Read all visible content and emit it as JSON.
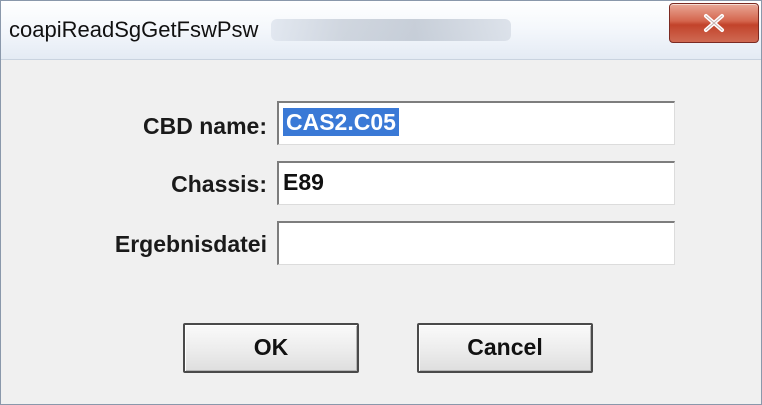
{
  "window": {
    "title": "coapiReadSgGetFswPsw",
    "close_icon": "close-icon"
  },
  "form": {
    "cbd_label": "CBD name:",
    "cbd_value": "CAS2.C05",
    "chassis_label": "Chassis:",
    "chassis_value": "E89",
    "result_label": "Ergebnisdatei",
    "result_value": ""
  },
  "buttons": {
    "ok_label": "OK",
    "cancel_label": "Cancel"
  },
  "colors": {
    "selection": "#3a79d6",
    "close_button": "#c9503a"
  }
}
